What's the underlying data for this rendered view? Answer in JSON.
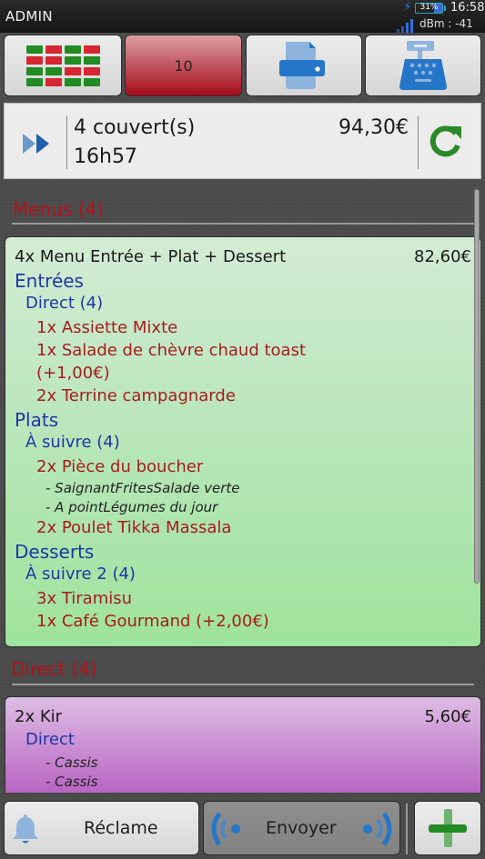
{
  "status_bar": {
    "app_title": "ADMIN",
    "battery_percent": "31%",
    "battery_level": 0.31,
    "time": "16:58",
    "signal_label": "dBm : -41"
  },
  "toolbar": {
    "tables_button_icon": "table-grid-icon",
    "table_number": "10",
    "print_button_icon": "printer-icon",
    "cash_register_button_icon": "cash-register-icon",
    "grid_pattern": [
      "G",
      "R",
      "G",
      "R",
      "R",
      "R",
      "G",
      "G",
      "G",
      "G",
      "R",
      "R",
      "G",
      "R",
      "G",
      "G"
    ],
    "colors": {
      "green": "#228b22",
      "red": "#d62632",
      "table_accent": "#a50c1a",
      "icon_blue": "#2576c8"
    }
  },
  "order_info": {
    "covers": "4 couvert(s)",
    "time": "16h57",
    "total": "94,30€",
    "next_icon": "fast-forward-icon",
    "refresh_icon": "refresh-icon"
  },
  "sections": [
    {
      "title": "Menus (4)",
      "cards": [
        {
          "color": "green",
          "title": "4x Menu Entrée + Plat + Dessert",
          "price": "82,60€",
          "lines": [
            {
              "type": "cat",
              "text": "Entrées"
            },
            {
              "type": "sub",
              "text": "Direct (4)"
            },
            {
              "type": "item",
              "text": "1x Assiette Mixte"
            },
            {
              "type": "item",
              "text": "1x Salade de chèvre chaud toast"
            },
            {
              "type": "item",
              "text": "(+1,00€)"
            },
            {
              "type": "item",
              "text": "2x Terrine campagnarde"
            },
            {
              "type": "cat",
              "text": "Plats"
            },
            {
              "type": "sub",
              "text": "À suivre (4)"
            },
            {
              "type": "item",
              "text": "2x Pièce du boucher"
            },
            {
              "type": "opt",
              "text": "- SaignantFritesSalade verte"
            },
            {
              "type": "opt",
              "text": "- A pointLégumes du jour"
            },
            {
              "type": "item",
              "text": "2x Poulet Tikka Massala"
            },
            {
              "type": "cat",
              "text": "Desserts"
            },
            {
              "type": "sub",
              "text": "À suivre 2 (4)"
            },
            {
              "type": "item",
              "text": "3x Tiramisu"
            },
            {
              "type": "item",
              "text": "1x Café Gourmand (+2,00€)"
            }
          ]
        }
      ]
    },
    {
      "title": "Direct (4)",
      "cards": [
        {
          "color": "purple",
          "title": "2x Kir",
          "price": "5,60€",
          "lines": [
            {
              "type": "sub",
              "text": "Direct"
            },
            {
              "type": "opt",
              "text": "- Cassis"
            },
            {
              "type": "opt",
              "text": "- Cassis"
            }
          ]
        }
      ]
    }
  ],
  "bottom_bar": {
    "reclame_label": "Réclame",
    "reclame_icon": "bell-icon",
    "envoyer_label": "Envoyer",
    "envoyer_icon": "broadcast-icon",
    "add_icon": "plus-icon"
  }
}
